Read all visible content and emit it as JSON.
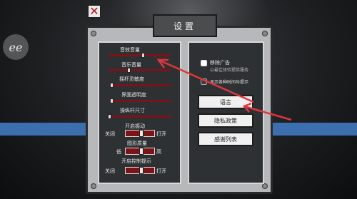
{
  "title": "设置",
  "close_icon": "close-icon",
  "logo_text": "ee",
  "left": {
    "sliders": [
      {
        "label": "音效音量",
        "value": 0.55
      },
      {
        "label": "音乐音量",
        "value": 0.3
      },
      {
        "label": "摇杆灵敏度",
        "value": 0.05
      },
      {
        "label": "界面透明度",
        "value": 0.05
      },
      {
        "label": "操纵杆尺寸",
        "value": 0.0
      }
    ],
    "toggles": [
      {
        "label": "开启振动",
        "off": "关闭",
        "on": "打开"
      },
      {
        "label": "图形质量",
        "off": "低",
        "on": "高"
      },
      {
        "label": "开启控制提示",
        "off": "关闭",
        "on": "打开"
      }
    ]
  },
  "right": {
    "options": [
      {
        "label": "移除广告",
        "sublabel": "以最佳体验提供服务"
      },
      {
        "label": "显示各种时间与提示"
      }
    ],
    "buttons": [
      "语言",
      "隐私政策",
      "感谢列表"
    ]
  },
  "colors": {
    "accent_red": "#7b1318",
    "arrow_red": "#e0353d",
    "panel_bg": "#2e3134",
    "blue": "#3b6fb0"
  }
}
